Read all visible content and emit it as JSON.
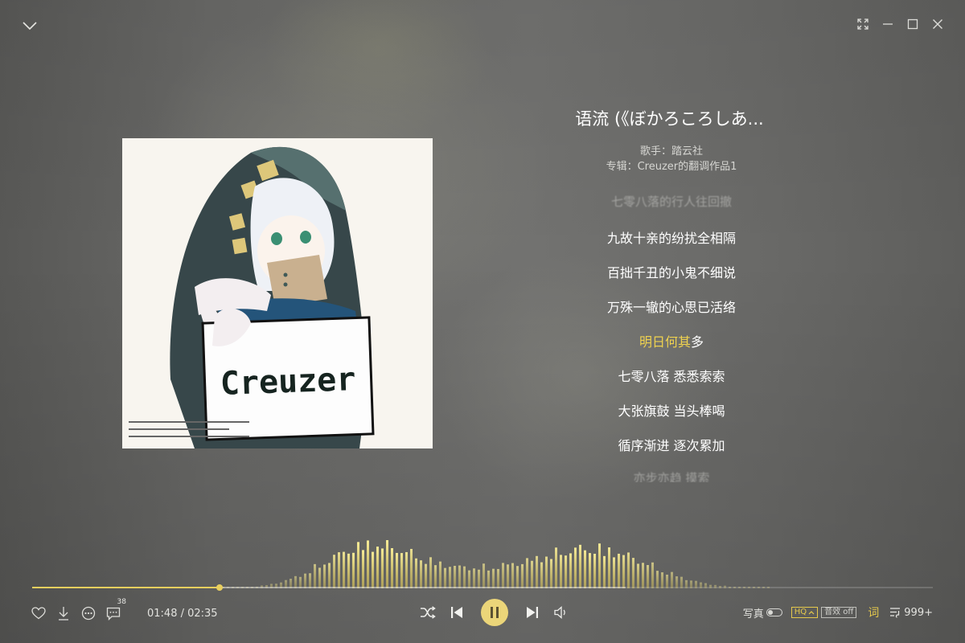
{
  "song": {
    "title": "语流 (《ぼかろころしあ...",
    "artist_line": "歌手：踏云社",
    "album_line": "专辑：Creuzer的翻调作品1"
  },
  "cover": {
    "sign_text": "Creuzer"
  },
  "lyrics": {
    "previous": "七零八落的行人往回撤",
    "lines": [
      "九故十亲的纷扰全相隔",
      "百拙千丑的小鬼不细说",
      "万殊一辙的心思已活络"
    ],
    "current_sung": "明日何其",
    "current_rest": "多",
    "after": [
      "七零八落 悉悉索索",
      "大张旗鼓 当头棒喝",
      "循序渐进 逐次累加"
    ],
    "next": "亦步亦趋 摸索"
  },
  "playback": {
    "time_display": "01:48 / 02:35",
    "progress": 0.2078,
    "buffered": 0.6593
  },
  "controls": {
    "comment_count": "38",
    "portrait_label": "写真",
    "hq_label": "HQ",
    "effect_label": "音效 off",
    "lyric_label": "词",
    "playlist_count": "999+"
  },
  "colors": {
    "accent": "#e9cf5e",
    "play_button": "#ebd579"
  },
  "icons": {
    "collapse": "chevron-down-icon",
    "fullscreen": "fullscreen-icon",
    "minimize": "minimize-icon",
    "maximize": "maximize-icon",
    "close": "close-icon",
    "like": "heart-icon",
    "download": "download-icon",
    "more": "more-icon",
    "comment": "comment-icon",
    "shuffle": "shuffle-icon",
    "prev": "previous-icon",
    "pause": "pause-icon",
    "next": "next-icon",
    "volume": "volume-icon",
    "playlist": "playlist-icon"
  }
}
